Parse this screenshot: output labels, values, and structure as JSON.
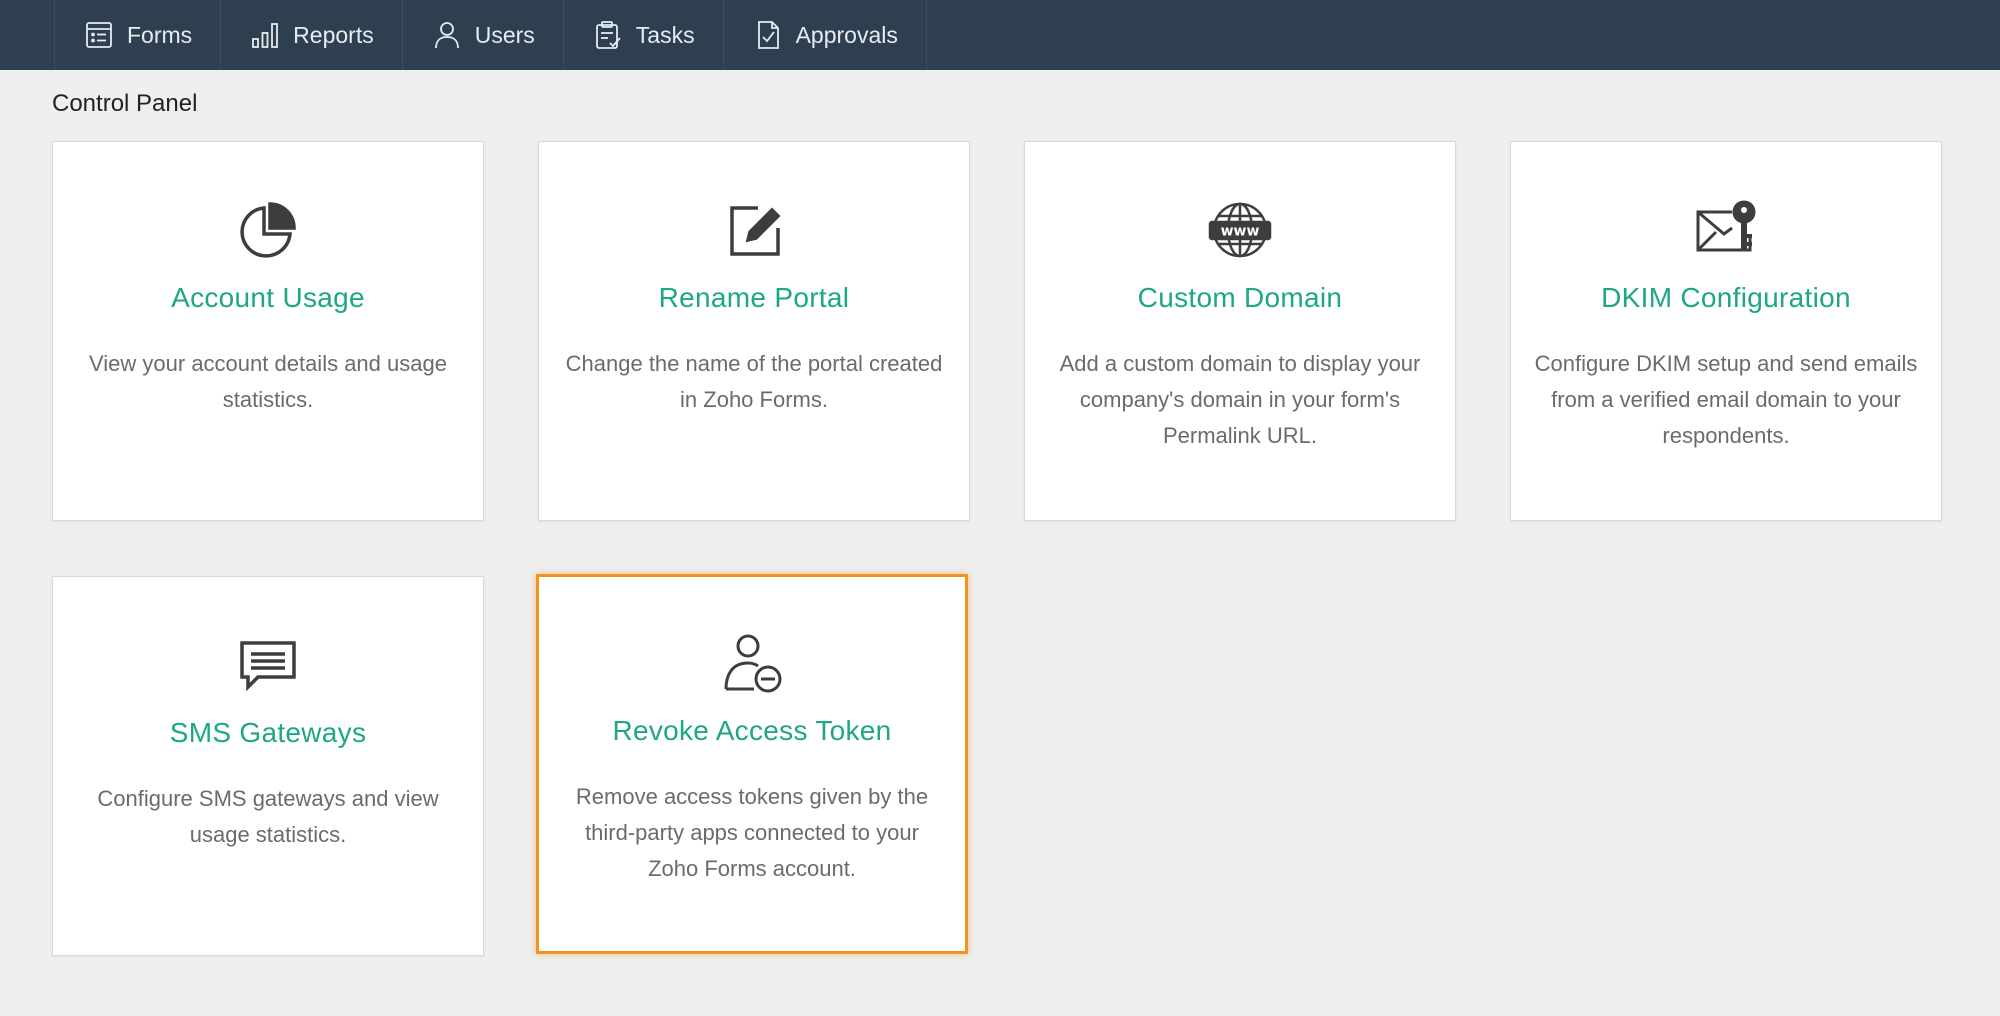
{
  "nav": {
    "items": [
      {
        "label": "Forms",
        "icon": "forms-icon"
      },
      {
        "label": "Reports",
        "icon": "reports-icon"
      },
      {
        "label": "Users",
        "icon": "user-icon"
      },
      {
        "label": "Tasks",
        "icon": "tasks-icon"
      },
      {
        "label": "Approvals",
        "icon": "approvals-icon"
      }
    ]
  },
  "page": {
    "title": "Control Panel"
  },
  "cards": [
    {
      "title": "Account Usage",
      "description": "View your account details and usage statistics.",
      "icon": "pie-chart-icon"
    },
    {
      "title": "Rename Portal",
      "description": "Change the name of the portal created in Zoho Forms.",
      "icon": "edit-icon"
    },
    {
      "title": "Custom Domain",
      "description": "Add a custom domain to display your company's domain in your form's Permalink URL.",
      "icon": "globe-www-icon"
    },
    {
      "title": "DKIM Configuration",
      "description": "Configure DKIM setup and send emails from a verified email domain to your respondents.",
      "icon": "envelope-key-icon"
    },
    {
      "title": "SMS Gateways",
      "description": "Configure SMS gateways and view usage statistics.",
      "icon": "chat-message-icon"
    },
    {
      "title": "Revoke Access Token",
      "description": "Remove access tokens given by the third-party apps connected to your Zoho Forms account.",
      "icon": "user-remove-icon",
      "selected": true
    }
  ],
  "colors": {
    "topbar": "#2e3f4f",
    "accent": "#1ea784",
    "selected_border": "#f0951e",
    "background": "#efefef"
  }
}
